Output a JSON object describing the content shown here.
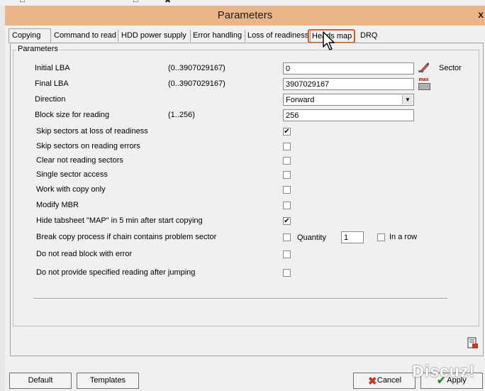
{
  "window": {
    "title": "Parameters",
    "close_label": "x"
  },
  "tabs": [
    {
      "label": "Copying",
      "active": true
    },
    {
      "label": "Command to read"
    },
    {
      "label": "HDD power supply"
    },
    {
      "label": "Error handling"
    },
    {
      "label": "Loss of readiness"
    },
    {
      "label": "Heads map",
      "highlighted": true
    },
    {
      "label": "DRQ"
    }
  ],
  "group": {
    "legend": "Parameters"
  },
  "fields": {
    "initial_lba": {
      "label": "Initial LBA",
      "range": "(0..3907029167)",
      "value": "0",
      "unit": "Sector"
    },
    "final_lba": {
      "label": "Final  LBA",
      "range": "(0..3907029167)",
      "value": "3907029167",
      "max_icon_label": "max"
    },
    "direction": {
      "label": "Direction",
      "value": "Forward"
    },
    "block_size": {
      "label": "Block size for reading",
      "range": "(1..256)",
      "value": "256"
    }
  },
  "options": [
    {
      "label": "Skip sectors at loss of readiness",
      "checked": true
    },
    {
      "label": "Skip sectors on reading errors",
      "checked": false
    },
    {
      "label": "Clear not reading sectors",
      "checked": false
    },
    {
      "label": "Single sector access",
      "checked": false
    },
    {
      "label": "Work with copy only",
      "checked": false
    },
    {
      "label": "Modify MBR",
      "checked": false
    },
    {
      "label": "Hide tabsheet \"MAP\" in 5 min after start copying",
      "checked": true
    },
    {
      "label": "Break copy process if chain contains problem sector",
      "checked": false
    },
    {
      "label": "Do not read block with error",
      "checked": false
    },
    {
      "label": "Do not provide specified reading after jumping",
      "checked": false
    }
  ],
  "break_copy": {
    "quantity_label": "Quantity",
    "quantity_value": "1",
    "in_a_row_label": "In a row",
    "in_a_row_checked": false
  },
  "footer": {
    "default_label": "Default",
    "templates_label": "Templates",
    "cancel_label": "Cancel",
    "apply_label": "Apply"
  },
  "watermark": "Discuz!",
  "icons": {
    "initial_lba_button": "edit-pencil-icon",
    "final_lba_button": "max-icon",
    "bottom_right": "report-icon"
  },
  "colors": {
    "titlebar": "#eab689",
    "tab_highlight": "#e05a1c",
    "cancel_icon": "#c0392b",
    "apply_icon": "#2e8b2e"
  }
}
